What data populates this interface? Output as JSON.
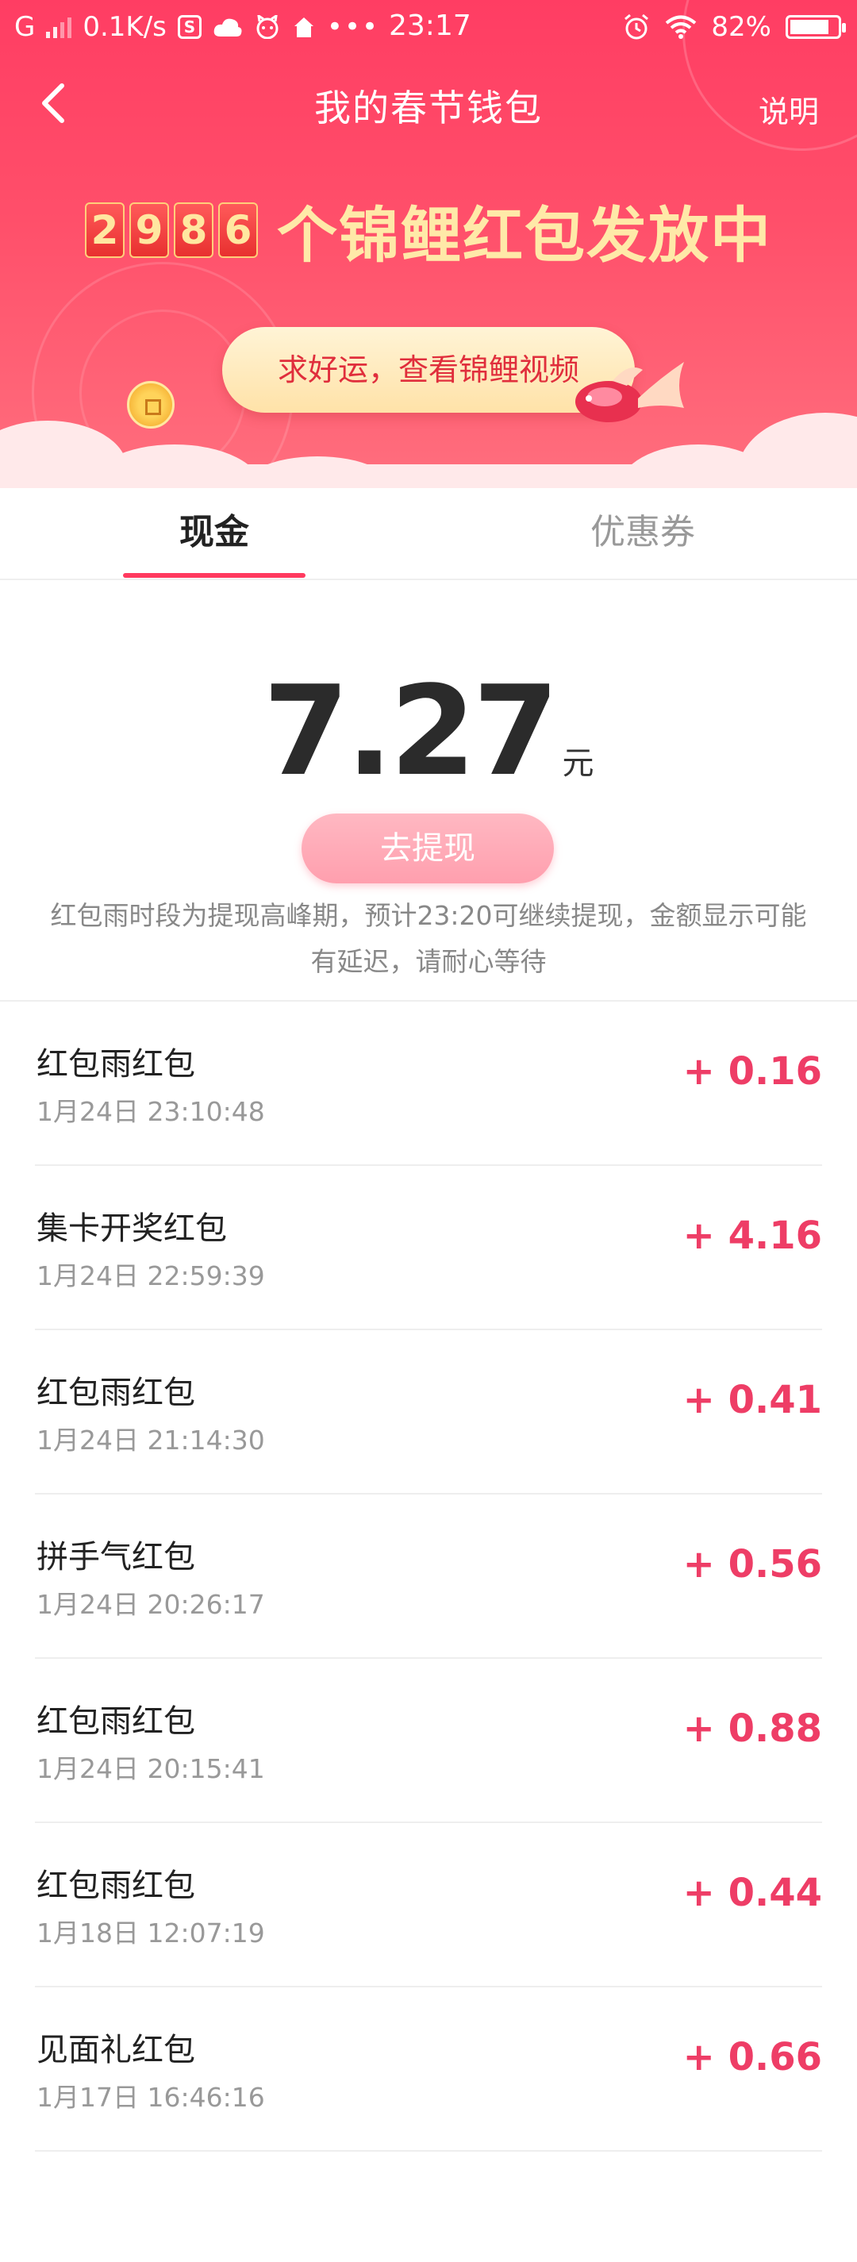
{
  "status_bar": {
    "network": "G",
    "speed": "0.1K/s",
    "time": "23:17",
    "battery": "82%",
    "battery_level": 0.82,
    "icons": [
      "signal-icon",
      "s-app-icon",
      "cloud-icon",
      "cat-icon",
      "home-icon",
      "more-dots-icon",
      "alarm-icon",
      "wifi-icon",
      "battery-icon"
    ]
  },
  "nav": {
    "title": "我的春节钱包",
    "help": "说明"
  },
  "banner": {
    "digits": [
      "2",
      "9",
      "8",
      "6"
    ],
    "counter_text": "个锦鲤红包发放中",
    "video_button": "求好运，查看锦鲤视频"
  },
  "tabs": {
    "cash": "现金",
    "coupon": "优惠券",
    "active": "cash"
  },
  "balance": {
    "amount": "7.27",
    "unit": "元",
    "withdraw": "去提现",
    "notice": "红包雨时段为提现高峰期，预计23:20可继续提现，金额显示可能有延迟，请耐心等待"
  },
  "transactions": [
    {
      "title": "红包雨红包",
      "time": "1月24日 23:10:48",
      "amount": "+ 0.16"
    },
    {
      "title": "集卡开奖红包",
      "time": "1月24日 22:59:39",
      "amount": "+ 4.16"
    },
    {
      "title": "红包雨红包",
      "time": "1月24日 21:14:30",
      "amount": "+ 0.41"
    },
    {
      "title": "拼手气红包",
      "time": "1月24日 20:26:17",
      "amount": "+ 0.56"
    },
    {
      "title": "红包雨红包",
      "time": "1月24日 20:15:41",
      "amount": "+ 0.88"
    },
    {
      "title": "红包雨红包",
      "time": "1月18日 12:07:19",
      "amount": "+ 0.44"
    },
    {
      "title": "见面礼红包",
      "time": "1月17日 16:46:16",
      "amount": "+ 0.66"
    }
  ],
  "colors": {
    "brand_red": "#ff3d63",
    "amount_red": "#ee3d66",
    "gold": "#ffe9a8"
  }
}
